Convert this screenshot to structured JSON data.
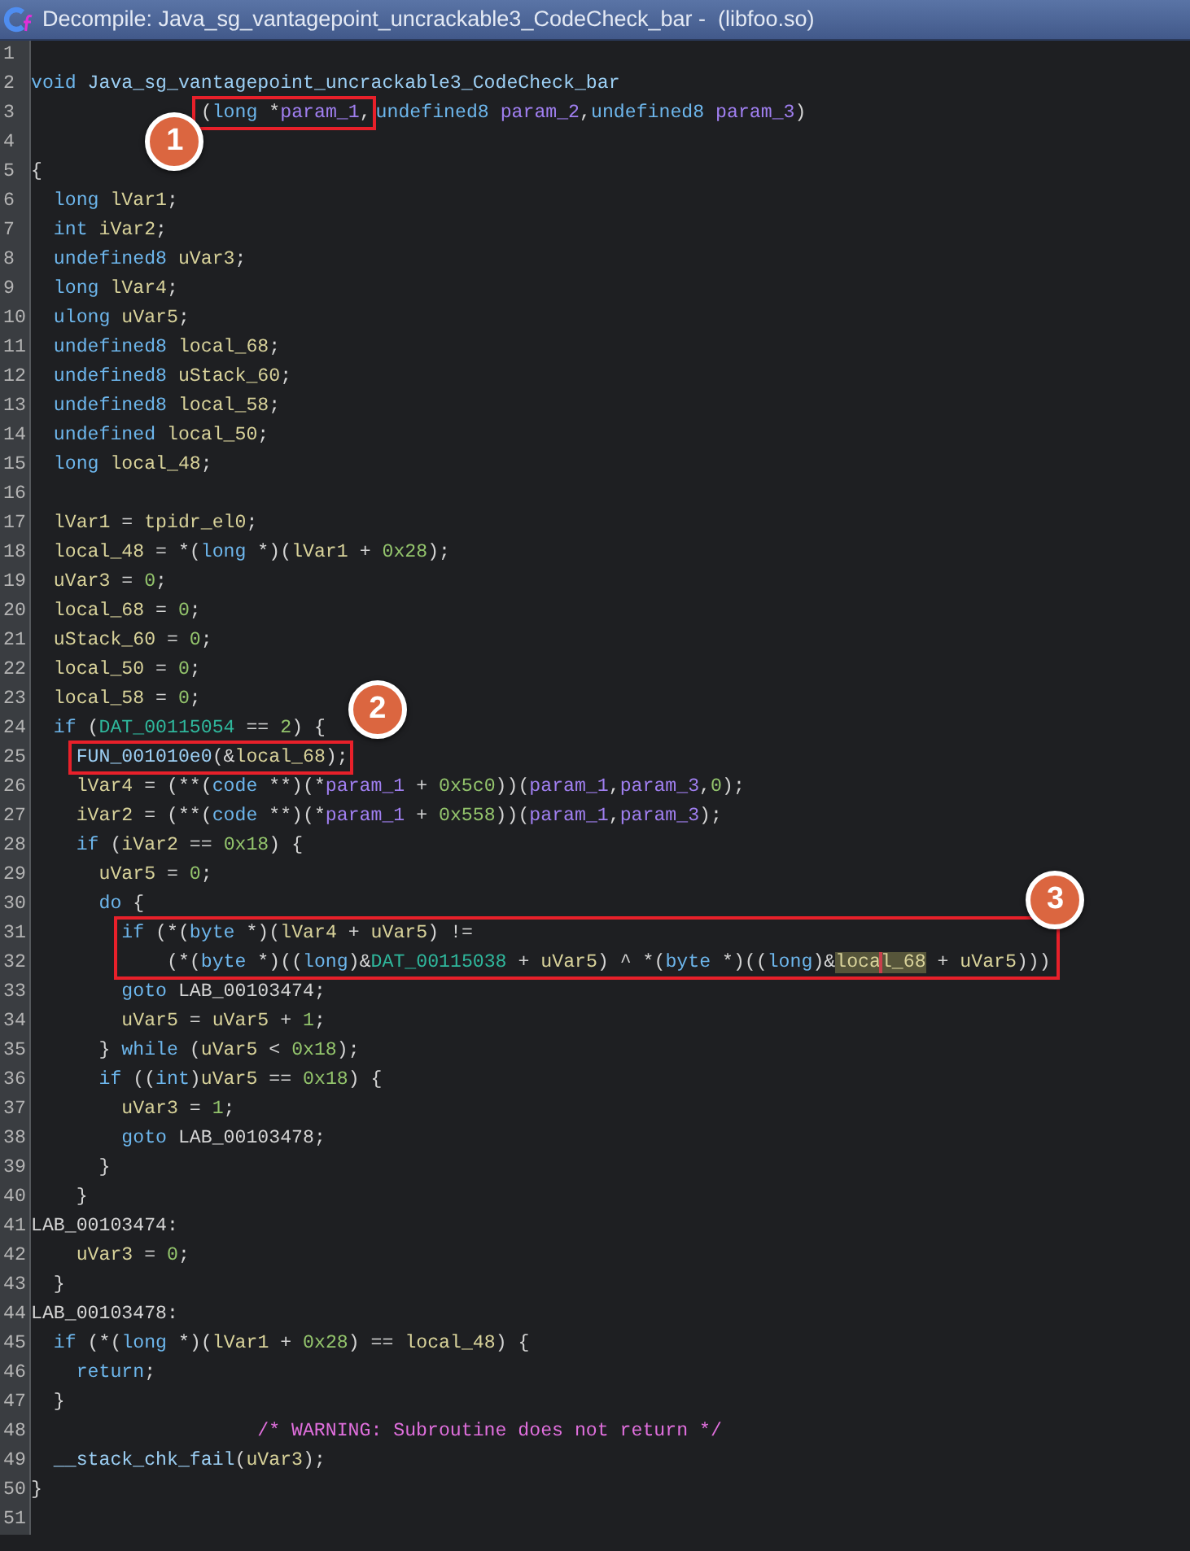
{
  "window": {
    "title": "Decompile: Java_sg_vantagepoint_uncrackable3_CodeCheck_bar -  (libfoo.so)"
  },
  "lines": [
    {
      "number": "1"
    },
    {
      "number": "2",
      "tokens": [
        {
          "kind": "keyword",
          "text": "void"
        },
        {
          "kind": "function",
          "text": " Java_sg_vantagepoint_uncrackable3_CodeCheck_bar"
        }
      ]
    },
    {
      "number": "3",
      "tokens": [
        {
          "kind": "boxed",
          "callout": "1",
          "tokens": [
            {
              "kind": "plain",
              "text": "               ("
            },
            {
              "kind": "keyword",
              "text": "long"
            },
            {
              "kind": "plain",
              "text": " *"
            },
            {
              "kind": "param",
              "text": "param_1"
            },
            {
              "kind": "plain",
              "text": ","
            }
          ]
        },
        {
          "kind": "keyword",
          "text": "undefined8"
        },
        {
          "kind": "param",
          "text": " param_2"
        },
        {
          "kind": "plain",
          "text": ","
        },
        {
          "kind": "keyword",
          "text": "undefined8"
        },
        {
          "kind": "param",
          "text": " param_3"
        },
        {
          "kind": "plain",
          "text": ")"
        }
      ]
    },
    {
      "number": "4"
    },
    {
      "number": "5",
      "tokens": [
        {
          "kind": "plain",
          "text": "{"
        }
      ]
    },
    {
      "number": "6",
      "tokens": [
        {
          "kind": "keyword",
          "text": "  long"
        },
        {
          "kind": "var",
          "text": " lVar1"
        },
        {
          "kind": "plain",
          "text": ";"
        }
      ]
    },
    {
      "number": "7",
      "tokens": [
        {
          "kind": "keyword",
          "text": "  int"
        },
        {
          "kind": "var",
          "text": " iVar2"
        },
        {
          "kind": "plain",
          "text": ";"
        }
      ]
    },
    {
      "number": "8",
      "tokens": [
        {
          "kind": "keyword",
          "text": "  undefined8"
        },
        {
          "kind": "var",
          "text": " uVar3"
        },
        {
          "kind": "plain",
          "text": ";"
        }
      ]
    },
    {
      "number": "9",
      "tokens": [
        {
          "kind": "keyword",
          "text": "  long"
        },
        {
          "kind": "var",
          "text": " lVar4"
        },
        {
          "kind": "plain",
          "text": ";"
        }
      ]
    },
    {
      "number": "10",
      "tokens": [
        {
          "kind": "keyword",
          "text": "  ulong"
        },
        {
          "kind": "var",
          "text": " uVar5"
        },
        {
          "kind": "plain",
          "text": ";"
        }
      ]
    },
    {
      "number": "11",
      "tokens": [
        {
          "kind": "keyword",
          "text": "  undefined8"
        },
        {
          "kind": "var",
          "text": " local_68"
        },
        {
          "kind": "plain",
          "text": ";"
        }
      ]
    },
    {
      "number": "12",
      "tokens": [
        {
          "kind": "keyword",
          "text": "  undefined8"
        },
        {
          "kind": "var",
          "text": " uStack_60"
        },
        {
          "kind": "plain",
          "text": ";"
        }
      ]
    },
    {
      "number": "13",
      "tokens": [
        {
          "kind": "keyword",
          "text": "  undefined8"
        },
        {
          "kind": "var",
          "text": " local_58"
        },
        {
          "kind": "plain",
          "text": ";"
        }
      ]
    },
    {
      "number": "14",
      "tokens": [
        {
          "kind": "keyword",
          "text": "  undefined"
        },
        {
          "kind": "var",
          "text": " local_50"
        },
        {
          "kind": "plain",
          "text": ";"
        }
      ]
    },
    {
      "number": "15",
      "tokens": [
        {
          "kind": "keyword",
          "text": "  long"
        },
        {
          "kind": "var",
          "text": " local_48"
        },
        {
          "kind": "plain",
          "text": ";"
        }
      ]
    },
    {
      "number": "16"
    },
    {
      "number": "17",
      "tokens": [
        {
          "kind": "var",
          "text": "  lVar1"
        },
        {
          "kind": "plain",
          "text": " = "
        },
        {
          "kind": "var",
          "text": "tpidr_el0"
        },
        {
          "kind": "plain",
          "text": ";"
        }
      ]
    },
    {
      "number": "18",
      "tokens": [
        {
          "kind": "var",
          "text": "  local_48"
        },
        {
          "kind": "plain",
          "text": " = *("
        },
        {
          "kind": "keyword",
          "text": "long"
        },
        {
          "kind": "plain",
          "text": " *)("
        },
        {
          "kind": "var",
          "text": "lVar1"
        },
        {
          "kind": "plain",
          "text": " + "
        },
        {
          "kind": "number",
          "text": "0x28"
        },
        {
          "kind": "plain",
          "text": ");"
        }
      ]
    },
    {
      "number": "19",
      "tokens": [
        {
          "kind": "var",
          "text": "  uVar3"
        },
        {
          "kind": "plain",
          "text": " = "
        },
        {
          "kind": "number",
          "text": "0"
        },
        {
          "kind": "plain",
          "text": ";"
        }
      ]
    },
    {
      "number": "20",
      "tokens": [
        {
          "kind": "var",
          "text": "  local_68"
        },
        {
          "kind": "plain",
          "text": " = "
        },
        {
          "kind": "number",
          "text": "0"
        },
        {
          "kind": "plain",
          "text": ";"
        }
      ]
    },
    {
      "number": "21",
      "tokens": [
        {
          "kind": "var",
          "text": "  uStack_60"
        },
        {
          "kind": "plain",
          "text": " = "
        },
        {
          "kind": "number",
          "text": "0"
        },
        {
          "kind": "plain",
          "text": ";"
        }
      ]
    },
    {
      "number": "22",
      "tokens": [
        {
          "kind": "var",
          "text": "  local_50"
        },
        {
          "kind": "plain",
          "text": " = "
        },
        {
          "kind": "number",
          "text": "0"
        },
        {
          "kind": "plain",
          "text": ";"
        }
      ]
    },
    {
      "number": "23",
      "tokens": [
        {
          "kind": "var",
          "text": "  local_58"
        },
        {
          "kind": "plain",
          "text": " = "
        },
        {
          "kind": "number",
          "text": "0"
        },
        {
          "kind": "plain",
          "text": ";"
        }
      ]
    },
    {
      "number": "24",
      "tokens": [
        {
          "kind": "keyword",
          "text": "  if"
        },
        {
          "kind": "plain",
          "text": " ("
        },
        {
          "kind": "global",
          "text": "DAT_00115054"
        },
        {
          "kind": "plain",
          "text": " == "
        },
        {
          "kind": "number",
          "text": "2"
        },
        {
          "kind": "plain",
          "text": ") {"
        }
      ]
    },
    {
      "number": "25",
      "tokens": [
        {
          "kind": "boxed",
          "callout": "2",
          "tokens": [
            {
              "kind": "function",
              "text": "    FUN_001010e0"
            },
            {
              "kind": "plain",
              "text": "(&"
            },
            {
              "kind": "var",
              "text": "local_68"
            },
            {
              "kind": "plain",
              "text": ");"
            }
          ]
        }
      ]
    },
    {
      "number": "26",
      "tokens": [
        {
          "kind": "var",
          "text": "    lVar4"
        },
        {
          "kind": "plain",
          "text": " = (**("
        },
        {
          "kind": "keyword",
          "text": "code"
        },
        {
          "kind": "plain",
          "text": " **)(*"
        },
        {
          "kind": "param",
          "text": "param_1"
        },
        {
          "kind": "plain",
          "text": " + "
        },
        {
          "kind": "number",
          "text": "0x5c0"
        },
        {
          "kind": "plain",
          "text": "))("
        },
        {
          "kind": "param",
          "text": "param_1"
        },
        {
          "kind": "plain",
          "text": ","
        },
        {
          "kind": "param",
          "text": "param_3"
        },
        {
          "kind": "plain",
          "text": ","
        },
        {
          "kind": "number",
          "text": "0"
        },
        {
          "kind": "plain",
          "text": ");"
        }
      ]
    },
    {
      "number": "27",
      "tokens": [
        {
          "kind": "var",
          "text": "    iVar2"
        },
        {
          "kind": "plain",
          "text": " = (**("
        },
        {
          "kind": "keyword",
          "text": "code"
        },
        {
          "kind": "plain",
          "text": " **)(*"
        },
        {
          "kind": "param",
          "text": "param_1"
        },
        {
          "kind": "plain",
          "text": " + "
        },
        {
          "kind": "number",
          "text": "0x558"
        },
        {
          "kind": "plain",
          "text": "))("
        },
        {
          "kind": "param",
          "text": "param_1"
        },
        {
          "kind": "plain",
          "text": ","
        },
        {
          "kind": "param",
          "text": "param_3"
        },
        {
          "kind": "plain",
          "text": ");"
        }
      ]
    },
    {
      "number": "28",
      "tokens": [
        {
          "kind": "keyword",
          "text": "    if"
        },
        {
          "kind": "plain",
          "text": " ("
        },
        {
          "kind": "var",
          "text": "iVar2"
        },
        {
          "kind": "plain",
          "text": " == "
        },
        {
          "kind": "number",
          "text": "0x18"
        },
        {
          "kind": "plain",
          "text": ") {"
        }
      ]
    },
    {
      "number": "29",
      "tokens": [
        {
          "kind": "var",
          "text": "      uVar5"
        },
        {
          "kind": "plain",
          "text": " = "
        },
        {
          "kind": "number",
          "text": "0"
        },
        {
          "kind": "plain",
          "text": ";"
        }
      ]
    },
    {
      "number": "30",
      "tokens": [
        {
          "kind": "keyword",
          "text": "      do"
        },
        {
          "kind": "plain",
          "text": " {"
        }
      ]
    },
    {
      "kind": "boxed",
      "callout": "3",
      "lines": [
        {
          "number": "31",
          "tokens": [
            {
              "kind": "keyword",
              "text": "        if"
            },
            {
              "kind": "plain",
              "text": " (*("
            },
            {
              "kind": "keyword",
              "text": "byte"
            },
            {
              "kind": "plain",
              "text": " *)("
            },
            {
              "kind": "var",
              "text": "lVar4"
            },
            {
              "kind": "plain",
              "text": " + "
            },
            {
              "kind": "var",
              "text": "uVar5"
            },
            {
              "kind": "plain",
              "text": ") !="
            }
          ]
        },
        {
          "number": "32",
          "tokens": [
            {
              "kind": "plain",
              "text": "            (*("
            },
            {
              "kind": "keyword",
              "text": "byte"
            },
            {
              "kind": "plain",
              "text": " *)(("
            },
            {
              "kind": "keyword",
              "text": "long"
            },
            {
              "kind": "plain",
              "text": ")&"
            },
            {
              "kind": "global",
              "text": "DAT_00115038"
            },
            {
              "kind": "plain",
              "text": " + "
            },
            {
              "kind": "var",
              "text": "uVar5"
            },
            {
              "kind": "plain",
              "text": ") ^ *("
            },
            {
              "kind": "keyword",
              "text": "byte"
            },
            {
              "kind": "plain",
              "text": " *)(("
            },
            {
              "kind": "keyword",
              "text": "long"
            },
            {
              "kind": "plain",
              "text": ")&"
            },
            {
              "kind": "var",
              "text": "loca",
              "highlighted": true
            },
            {
              "kind": "cursor"
            },
            {
              "kind": "var",
              "text": "l_68",
              "highlighted": true
            },
            {
              "kind": "plain",
              "text": " + "
            },
            {
              "kind": "var",
              "text": "uVar5"
            },
            {
              "kind": "plain",
              "text": ")))"
            }
          ]
        }
      ]
    },
    {
      "number": "33",
      "tokens": [
        {
          "kind": "keyword",
          "text": "        goto"
        },
        {
          "kind": "plain",
          "text": " LAB_00103474;"
        }
      ]
    },
    {
      "number": "34",
      "tokens": [
        {
          "kind": "var",
          "text": "        uVar5"
        },
        {
          "kind": "plain",
          "text": " = "
        },
        {
          "kind": "var",
          "text": "uVar5"
        },
        {
          "kind": "plain",
          "text": " + "
        },
        {
          "kind": "number",
          "text": "1"
        },
        {
          "kind": "plain",
          "text": ";"
        }
      ]
    },
    {
      "number": "35",
      "tokens": [
        {
          "kind": "plain",
          "text": "      } "
        },
        {
          "kind": "keyword",
          "text": "while"
        },
        {
          "kind": "plain",
          "text": " ("
        },
        {
          "kind": "var",
          "text": "uVar5"
        },
        {
          "kind": "plain",
          "text": " < "
        },
        {
          "kind": "number",
          "text": "0x18"
        },
        {
          "kind": "plain",
          "text": ");"
        }
      ]
    },
    {
      "number": "36",
      "tokens": [
        {
          "kind": "keyword",
          "text": "      if"
        },
        {
          "kind": "plain",
          "text": " (("
        },
        {
          "kind": "keyword",
          "text": "int"
        },
        {
          "kind": "plain",
          "text": ")"
        },
        {
          "kind": "var",
          "text": "uVar5"
        },
        {
          "kind": "plain",
          "text": " == "
        },
        {
          "kind": "number",
          "text": "0x18"
        },
        {
          "kind": "plain",
          "text": ") {"
        }
      ]
    },
    {
      "number": "37",
      "tokens": [
        {
          "kind": "var",
          "text": "        uVar3"
        },
        {
          "kind": "plain",
          "text": " = "
        },
        {
          "kind": "number",
          "text": "1"
        },
        {
          "kind": "plain",
          "text": ";"
        }
      ]
    },
    {
      "number": "38",
      "tokens": [
        {
          "kind": "keyword",
          "text": "        goto"
        },
        {
          "kind": "plain",
          "text": " LAB_00103478;"
        }
      ]
    },
    {
      "number": "39",
      "tokens": [
        {
          "kind": "plain",
          "text": "      }"
        }
      ]
    },
    {
      "number": "40",
      "tokens": [
        {
          "kind": "plain",
          "text": "    }"
        }
      ]
    },
    {
      "number": "41",
      "tokens": [
        {
          "kind": "plain",
          "text": "LAB_00103474:"
        }
      ]
    },
    {
      "number": "42",
      "tokens": [
        {
          "kind": "var",
          "text": "    uVar3"
        },
        {
          "kind": "plain",
          "text": " = "
        },
        {
          "kind": "number",
          "text": "0"
        },
        {
          "kind": "plain",
          "text": ";"
        }
      ]
    },
    {
      "number": "43",
      "tokens": [
        {
          "kind": "plain",
          "text": "  }"
        }
      ]
    },
    {
      "number": "44",
      "tokens": [
        {
          "kind": "plain",
          "text": "LAB_00103478:"
        }
      ]
    },
    {
      "number": "45",
      "tokens": [
        {
          "kind": "keyword",
          "text": "  if"
        },
        {
          "kind": "plain",
          "text": " (*("
        },
        {
          "kind": "keyword",
          "text": "long"
        },
        {
          "kind": "plain",
          "text": " *)("
        },
        {
          "kind": "var",
          "text": "lVar1"
        },
        {
          "kind": "plain",
          "text": " + "
        },
        {
          "kind": "number",
          "text": "0x28"
        },
        {
          "kind": "plain",
          "text": ") == "
        },
        {
          "kind": "var",
          "text": "local_48"
        },
        {
          "kind": "plain",
          "text": ") {"
        }
      ]
    },
    {
      "number": "46",
      "tokens": [
        {
          "kind": "keyword",
          "text": "    return"
        },
        {
          "kind": "plain",
          "text": ";"
        }
      ]
    },
    {
      "number": "47",
      "tokens": [
        {
          "kind": "plain",
          "text": "  }"
        }
      ]
    },
    {
      "number": "48",
      "tokens": [
        {
          "kind": "comment",
          "text": "                    /* WARNING: Subroutine does not return */"
        }
      ]
    },
    {
      "number": "49",
      "tokens": [
        {
          "kind": "function",
          "text": "  __stack_chk_fail"
        },
        {
          "kind": "plain",
          "text": "("
        },
        {
          "kind": "var",
          "text": "uVar3"
        },
        {
          "kind": "plain",
          "text": ");"
        }
      ]
    },
    {
      "number": "50",
      "tokens": [
        {
          "kind": "plain",
          "text": "}"
        }
      ]
    },
    {
      "number": "51"
    }
  ]
}
